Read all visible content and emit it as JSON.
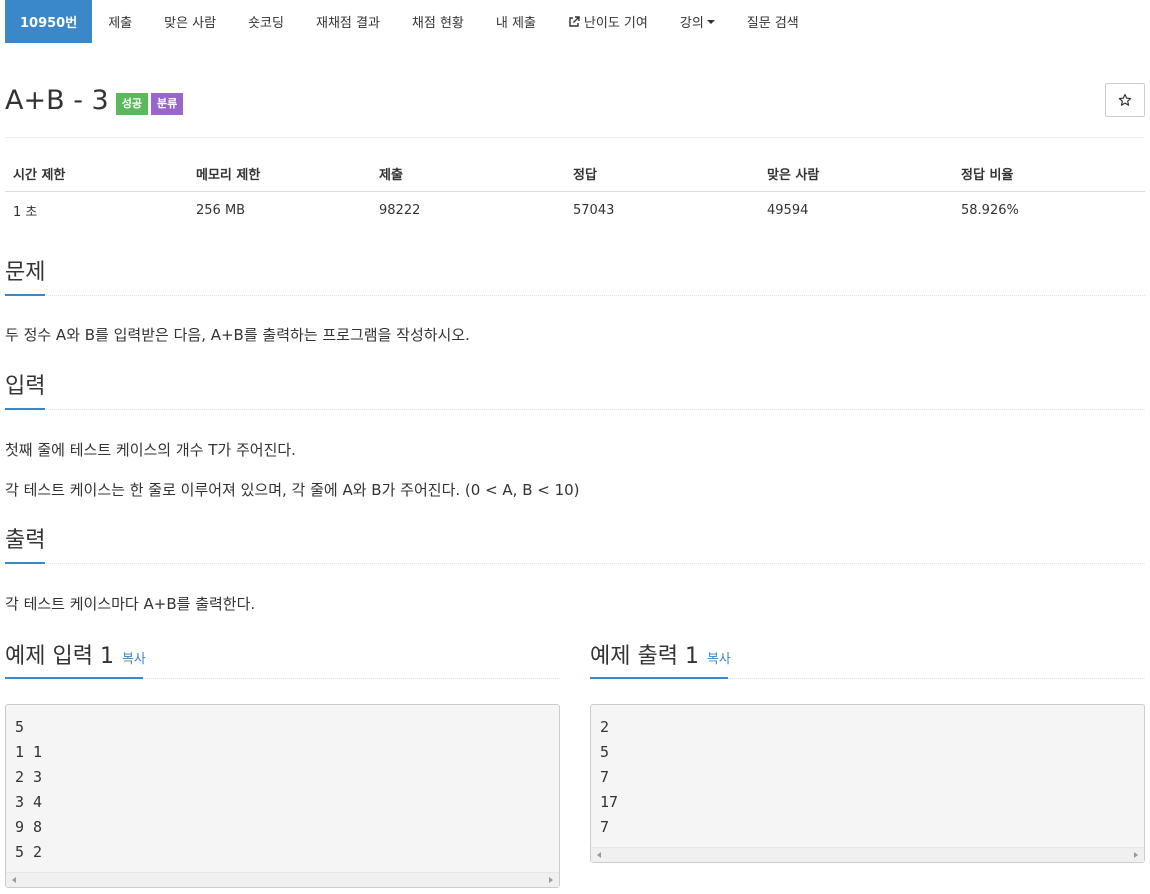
{
  "nav": {
    "items": [
      {
        "label": "10950번",
        "active": true
      },
      {
        "label": "제출"
      },
      {
        "label": "맞은 사람"
      },
      {
        "label": "숏코딩"
      },
      {
        "label": "재채점 결과"
      },
      {
        "label": "채점 현황"
      },
      {
        "label": "내 제출"
      },
      {
        "label": "난이도 기여",
        "icon": "external-link-icon"
      },
      {
        "label": "강의",
        "icon": "caret-down-icon"
      },
      {
        "label": "질문 검색"
      }
    ]
  },
  "problem": {
    "title": "A+B - 3",
    "badges": [
      {
        "label": "성공",
        "color": "#5cb85c"
      },
      {
        "label": "분류",
        "color": "#9966cc"
      }
    ],
    "star_icon": "star-outline-icon"
  },
  "stats": {
    "headers": [
      "시간 제한",
      "메모리 제한",
      "제출",
      "정답",
      "맞은 사람",
      "정답 비율"
    ],
    "values": [
      "1 초",
      "256 MB",
      "98222",
      "57043",
      "49594",
      "58.926%"
    ]
  },
  "sections": {
    "problem": {
      "heading": "문제",
      "text": "두 정수 A와 B를 입력받은 다음, A+B를 출력하는 프로그램을 작성하시오."
    },
    "input": {
      "heading": "입력",
      "lines": [
        "첫째 줄에 테스트 케이스의 개수 T가 주어진다.",
        "각 테스트 케이스는 한 줄로 이루어져 있으며, 각 줄에 A와 B가 주어진다. (0 < A, B < 10)"
      ]
    },
    "output": {
      "heading": "출력",
      "text": "각 테스트 케이스마다 A+B를 출력한다."
    }
  },
  "samples": {
    "input": {
      "heading": "예제 입력 1",
      "copy_label": "복사",
      "lines": [
        "5",
        "1 1",
        "2 3",
        "3 4",
        "9 8",
        "5 2"
      ]
    },
    "output": {
      "heading": "예제 출력 1",
      "copy_label": "복사",
      "lines": [
        "2",
        "5",
        "7",
        "17",
        "7"
      ]
    }
  },
  "colors": {
    "accent": "#3a87c9",
    "success_badge": "#5cb85c",
    "category_badge": "#9966cc"
  }
}
